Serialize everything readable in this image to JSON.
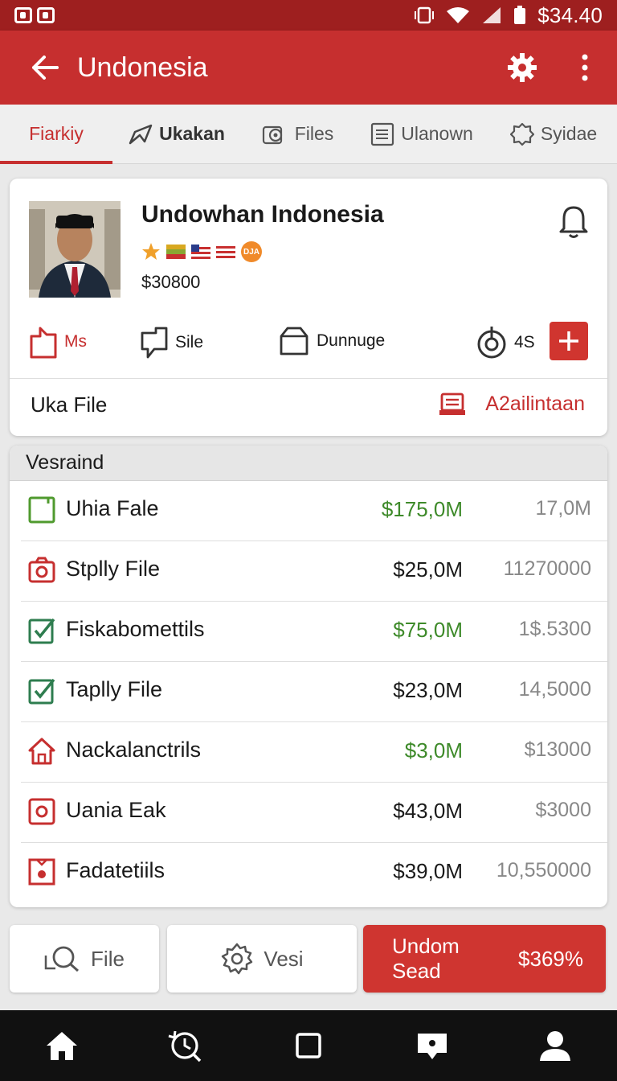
{
  "status_bar": {
    "time": "$34.40",
    "icons": [
      "app-icon",
      "app-icon",
      "vibrate-icon",
      "wifi-icon",
      "signal-icon",
      "battery-icon"
    ]
  },
  "app_bar": {
    "title": "Undonesia",
    "icons": [
      "back-arrow-icon",
      "gear-icon",
      "more-vert-icon"
    ],
    "color": "#c62f2f"
  },
  "tabs": [
    {
      "label": "Fiarkiy",
      "icon": "",
      "active": true
    },
    {
      "label": "Ukakan",
      "icon": "send-icon",
      "active": false
    },
    {
      "label": "Files",
      "icon": "scan-icon",
      "active": false
    },
    {
      "label": "Ulanown",
      "icon": "document-icon",
      "active": false
    },
    {
      "label": "Syidae",
      "icon": "badge-icon",
      "active": false
    }
  ],
  "profile": {
    "name": "Undowhan Indonesia",
    "price": "$30800",
    "badges": [
      "star-icon",
      "flag-icon",
      "flag-icon",
      "flag-icon",
      "orange-badge-icon"
    ],
    "badge_text": "DJA",
    "actions": [
      {
        "label": "Ms",
        "icon": "bag-icon",
        "color": "#c62f2f"
      },
      {
        "label": "Sile",
        "icon": "chat-icon",
        "color": "#333333"
      },
      {
        "label": "Dunnuge",
        "icon": "box-icon",
        "color": "#333333"
      },
      {
        "label": "4S",
        "icon": "target-icon",
        "color": "#333333"
      }
    ],
    "add_icon": "plus-icon",
    "file_label": "Uka File",
    "avail_label": "A2ailintaan"
  },
  "list": {
    "header": "Vesraind",
    "rows": [
      {
        "label": "Uhia Fale",
        "amount": "$175,0M",
        "alt": "17,0M",
        "icon": "square-icon",
        "green": true
      },
      {
        "label": "Stplly File",
        "amount": "$25,0M",
        "alt": "11270000",
        "icon": "camera-icon",
        "green": false
      },
      {
        "label": "Fiskabomettils",
        "amount": "$75,0M",
        "alt": "1$.5300",
        "icon": "check-square-icon",
        "green": true
      },
      {
        "label": "Taplly File",
        "amount": "$23,0M",
        "alt": "14,5000",
        "icon": "check-square-icon",
        "green": false
      },
      {
        "label": "Nackalanctrils",
        "amount": "$3,0M",
        "alt": "$13000",
        "icon": "house-icon",
        "green": true
      },
      {
        "label": "Uania Eak",
        "amount": "$43,0M",
        "alt": "$3000",
        "icon": "target-square-icon",
        "green": false
      },
      {
        "label": "Fadatetiils",
        "amount": "$39,0M",
        "alt": "10,550000",
        "icon": "receipt-icon",
        "green": false
      }
    ]
  },
  "bottom_buttons": {
    "file": "File",
    "vesi": "Vesi",
    "primary": "Undom Sead",
    "primary_value": "$369%"
  },
  "nav": [
    "home-icon",
    "history-icon",
    "square-icon",
    "chat-bubble-icon",
    "person-icon"
  ]
}
